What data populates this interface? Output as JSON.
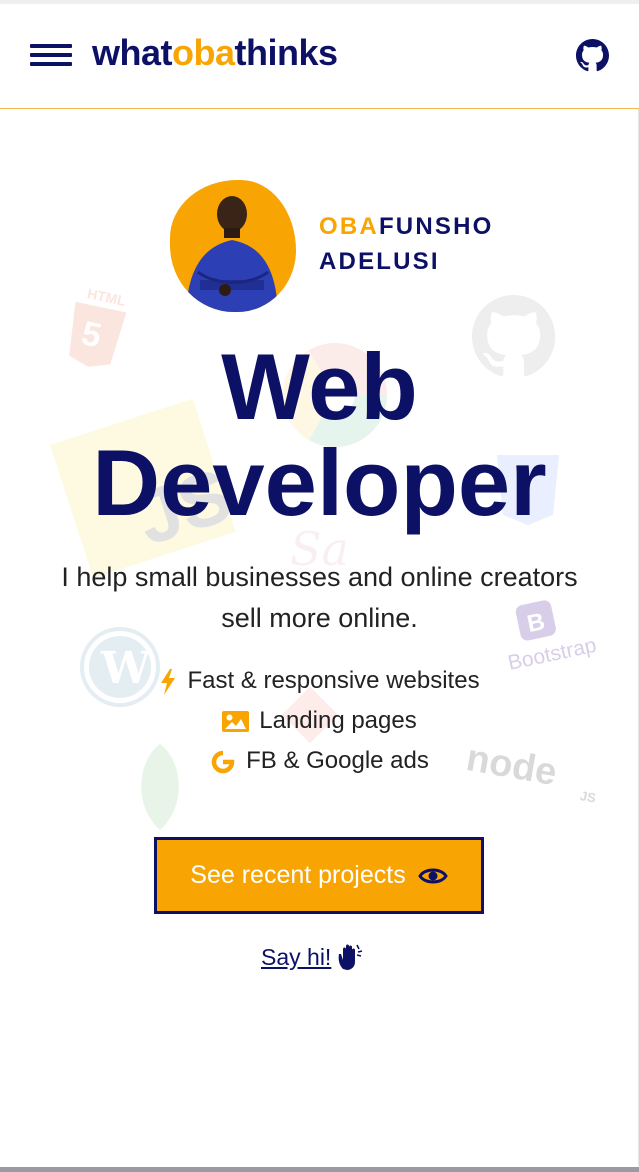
{
  "header": {
    "logo": {
      "part1": "what",
      "part2": "oba",
      "part3": "thinks"
    }
  },
  "hero": {
    "name_first_accent": "OBA",
    "name_first_rest": "FUNSHO",
    "name_last": "ADELUSI",
    "headline_line1": "Web",
    "headline_line2": "Developer",
    "tagline": "I help small businesses and online creators sell more online.",
    "features": [
      {
        "icon": "lightning-icon",
        "label": "Fast & responsive websites"
      },
      {
        "icon": "image-icon",
        "label": "Landing pages"
      },
      {
        "icon": "google-icon",
        "label": "FB & Google ads"
      }
    ],
    "cta_label": "See recent projects",
    "sayhi_label": "Say hi!"
  },
  "background_logos": {
    "html_label": "HTML",
    "bootstrap_label": "Bootstrap",
    "node_label": "node",
    "node_sub": "JS"
  },
  "colors": {
    "navy": "#0d1166",
    "accent": "#f8a504"
  }
}
